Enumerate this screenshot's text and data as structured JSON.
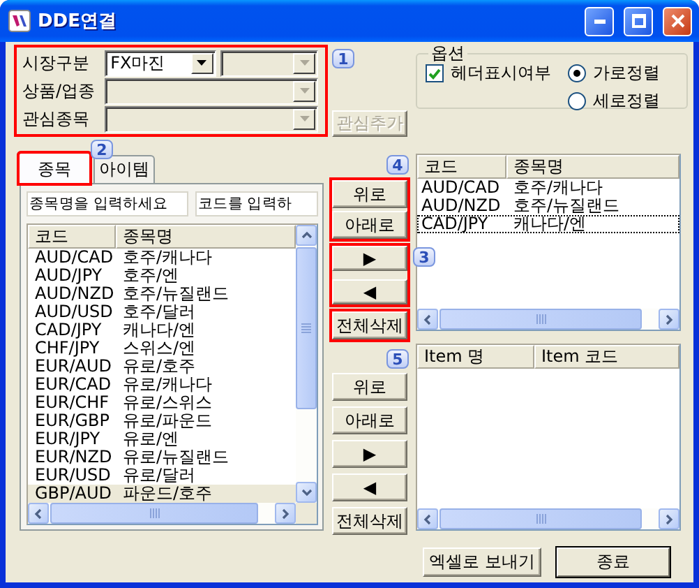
{
  "window": {
    "title": "DDE연결"
  },
  "filter_panel": {
    "badge": "1",
    "rows": [
      {
        "label": "시장구분",
        "combos": [
          {
            "value": "FX마진",
            "disabled": false
          },
          {
            "disabled": true
          }
        ]
      },
      {
        "label": "상품/업종",
        "combos": [
          {
            "disabled": true
          }
        ]
      },
      {
        "label": "관심종목",
        "combos": [
          {
            "disabled": true
          }
        ]
      }
    ],
    "add_button": {
      "label": "관심추가",
      "disabled": true
    }
  },
  "options": {
    "title": "옵션",
    "header_checkbox": {
      "label": "헤더표시여부",
      "checked": true
    },
    "orientation": [
      {
        "label": "가로정렬",
        "selected": true
      },
      {
        "label": "세로정렬",
        "selected": false
      }
    ]
  },
  "tabs": {
    "badge": "2",
    "items": [
      {
        "label": "종목",
        "selected": true,
        "outlined": true
      },
      {
        "label": "아이템",
        "selected": false,
        "outlined": false
      }
    ]
  },
  "search_fields": [
    {
      "value": "종목명을 입력하세요"
    },
    {
      "value": "코드를 입력하"
    }
  ],
  "symbol_list": {
    "columns": [
      "코드",
      "종목명"
    ],
    "rows": [
      {
        "code": "AUD/CAD",
        "name": "호주/캐나다",
        "selected": false
      },
      {
        "code": "AUD/JPY",
        "name": "호주/엔",
        "selected": false
      },
      {
        "code": "AUD/NZD",
        "name": "호주/뉴질랜드",
        "selected": false
      },
      {
        "code": "AUD/USD",
        "name": "호주/달러",
        "selected": false
      },
      {
        "code": "CAD/JPY",
        "name": "캐나다/엔",
        "selected": false
      },
      {
        "code": "CHF/JPY",
        "name": "스위스/엔",
        "selected": false
      },
      {
        "code": "EUR/AUD",
        "name": "유로/호주",
        "selected": false
      },
      {
        "code": "EUR/CAD",
        "name": "유로/캐나다",
        "selected": false
      },
      {
        "code": "EUR/CHF",
        "name": "유로/스위스",
        "selected": false
      },
      {
        "code": "EUR/GBP",
        "name": "유로/파운드",
        "selected": false
      },
      {
        "code": "EUR/JPY",
        "name": "유로/엔",
        "selected": false
      },
      {
        "code": "EUR/NZD",
        "name": "유로/뉴질랜드",
        "selected": false
      },
      {
        "code": "EUR/USD",
        "name": "유로/달러",
        "selected": false
      },
      {
        "code": "GBP/AUD",
        "name": "파운드/호주",
        "selected": true
      }
    ]
  },
  "symbol_controls": {
    "groups": [
      {
        "kind": "order",
        "badge": "4",
        "buttons": [
          "위로",
          "아래로"
        ]
      },
      {
        "kind": "move",
        "badge": "3",
        "buttons": [
          "▶",
          "◀"
        ]
      },
      {
        "kind": "clear",
        "buttons": [
          "전체삭제"
        ]
      }
    ]
  },
  "selected_list": {
    "columns": [
      "코드",
      "종목명"
    ],
    "rows": [
      {
        "code": "AUD/CAD",
        "name": "호주/캐나다",
        "focused": false
      },
      {
        "code": "AUD/NZD",
        "name": "호주/뉴질랜드",
        "focused": false
      },
      {
        "code": "CAD/JPY",
        "name": "캐나다/엔",
        "focused": true
      }
    ]
  },
  "item_controls": {
    "badge": "5",
    "buttons": [
      "위로",
      "아래로",
      "▶",
      "◀",
      "전체삭제"
    ]
  },
  "item_list": {
    "columns": [
      "Item 명",
      "Item 코드"
    ]
  },
  "footer_buttons": [
    {
      "label": "엑셀로 보내기",
      "default": false
    },
    {
      "label": "종료",
      "default": true
    }
  ]
}
